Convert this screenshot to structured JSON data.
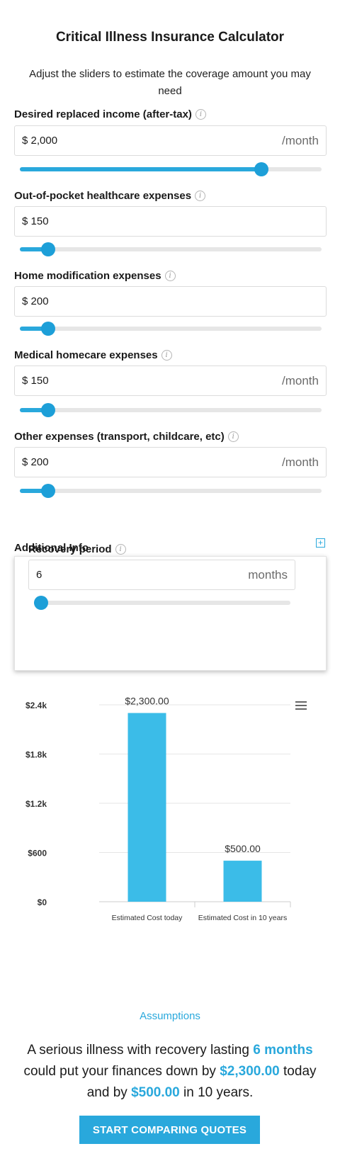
{
  "title": "Critical Illness Insurance Calculator",
  "subtitle": "Adjust the sliders to estimate the coverage amount you may need",
  "fields": [
    {
      "label": "Desired replaced income (after-tax)",
      "value": "$ 2,000",
      "suffix": "/month",
      "slider_fraction": 0.8
    },
    {
      "label": "Out-of-pocket healthcare expenses",
      "value": "$ 150",
      "suffix": "",
      "slider_fraction": 0.095
    },
    {
      "label": "Home modification expenses",
      "value": "$ 200",
      "suffix": "",
      "slider_fraction": 0.095
    },
    {
      "label": "Medical homecare expenses",
      "value": "$ 150",
      "suffix": "/month",
      "slider_fraction": 0.095
    },
    {
      "label": "Other expenses (transport, childcare, etc)",
      "value": "$ 200",
      "suffix": "/month",
      "slider_fraction": 0.095
    }
  ],
  "additional": {
    "label": "Additional Info",
    "recovery_label": "Recovery period",
    "recovery_value": "6",
    "recovery_suffix": "months",
    "recovery_fraction": 0.0
  },
  "chart_data": {
    "type": "bar",
    "categories": [
      "Estimated Cost today",
      "Estimated Cost in 10 years"
    ],
    "values": [
      2300,
      500
    ],
    "data_labels": [
      "$2,300.00",
      "$500.00"
    ],
    "y_ticks": [
      "$0",
      "$600",
      "$1.2k",
      "$1.8k",
      "$2.4k"
    ],
    "ylim": [
      0,
      2400
    ],
    "color": "#3bbce8",
    "grid": true
  },
  "assumptions": "Assumptions",
  "summary": {
    "p1": "A serious illness with recovery lasting ",
    "months": "6 months",
    "p2": " could put your finances down by ",
    "today": "$2,300.00",
    "p3": " today and by ",
    "later": "$500.00",
    "p4": " in 10 years."
  },
  "cta_label": "START COMPARING QUOTES",
  "colors": {
    "accent": "#29a8dc"
  }
}
